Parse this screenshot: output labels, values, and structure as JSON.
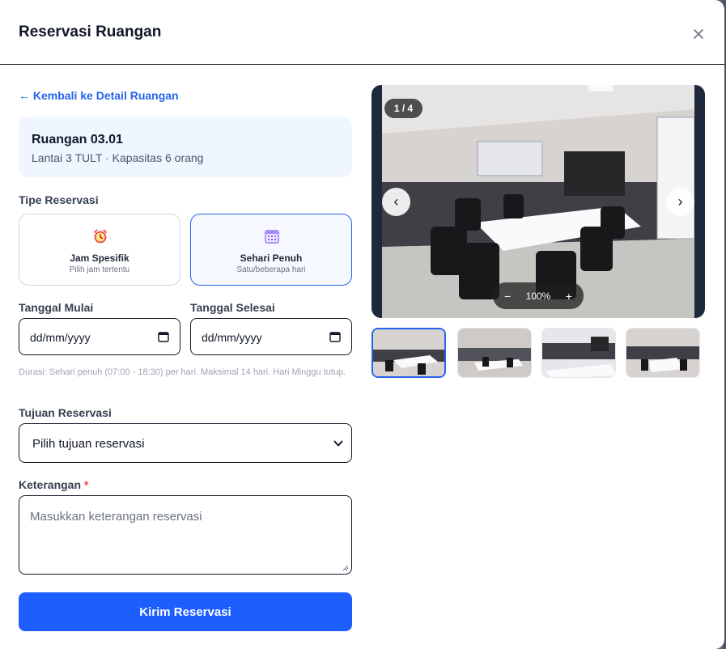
{
  "modal": {
    "title": "Reservasi Ruangan",
    "close_label": "×"
  },
  "back_link": "← Kembali ke Detail Ruangan",
  "room": {
    "name": "Ruangan 03.01",
    "meta": "Lantai 3 TULT · Kapasitas 6 orang"
  },
  "reservation_type": {
    "label": "Tipe Reservasi",
    "options": [
      {
        "title": "Jam Spesifik",
        "subtitle": "Pilih jam tertentu",
        "icon": "alarm-clock-icon",
        "selected": false
      },
      {
        "title": "Sehari Penuh",
        "subtitle": "Satu/beberapa hari",
        "icon": "calendar-icon",
        "selected": true
      }
    ]
  },
  "dates": {
    "start_label": "Tanggal Mulai",
    "end_label": "Tanggal Selesai",
    "start_value": "dd/mm/yyyy",
    "end_value": "dd/mm/yyyy",
    "hint": "Durasi: Sehari penuh (07:00 - 18:30) per hari. Maksimal 14 hari. Hari Minggu tutup."
  },
  "purpose": {
    "label": "Tujuan Reservasi",
    "selected": "Pilih tujuan reservasi"
  },
  "notes": {
    "label": "Keterangan",
    "required_mark": "*",
    "placeholder": "Masukkan keterangan reservasi"
  },
  "submit_label": "Kirim Reservasi",
  "gallery": {
    "counter": "1 / 4",
    "prev_label": "‹",
    "next_label": "›",
    "zoom_out": "−",
    "zoom_level": "100%",
    "zoom_in": "+",
    "thumbnail_count": 4,
    "active_index": 0
  },
  "colors": {
    "primary": "#1d5eff",
    "link": "#2563eb",
    "card_bg": "#eff6ff",
    "required": "#ef4444"
  }
}
